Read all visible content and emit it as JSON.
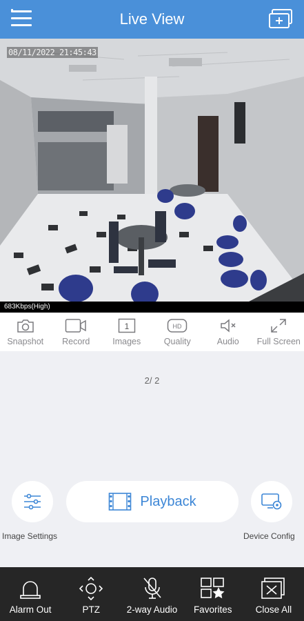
{
  "header": {
    "title": "Live View",
    "menu_icon": "hamburger-menu-icon",
    "split_icon": "add-window-icon"
  },
  "video": {
    "osd_timestamp": "08/11/2022 21:45:43",
    "bitrate_label": "683Kbps(High)"
  },
  "toolbar": {
    "items": [
      {
        "label": "Snapshot",
        "icon": "camera-icon"
      },
      {
        "label": "Record",
        "icon": "video-record-icon"
      },
      {
        "label": "Images",
        "icon": "images-icon",
        "badge": "1"
      },
      {
        "label": "Quality",
        "icon": "hd-quality-icon",
        "badge": "HD"
      },
      {
        "label": "Audio",
        "icon": "speaker-muted-icon"
      },
      {
        "label": "Full Screen",
        "icon": "fullscreen-icon"
      }
    ]
  },
  "main": {
    "page_indicator": "2/ 2",
    "image_settings_label": "Image Settings",
    "playback_label": "Playback",
    "device_config_label": "Device Config"
  },
  "bottombar": {
    "items": [
      {
        "label": "Alarm Out",
        "icon": "alarm-light-icon"
      },
      {
        "label": "PTZ",
        "icon": "ptz-direction-icon"
      },
      {
        "label": "2-way Audio",
        "icon": "microphone-muted-icon"
      },
      {
        "label": "Favorites",
        "icon": "favorites-star-icon"
      },
      {
        "label": "Close All",
        "icon": "close-all-icon"
      }
    ]
  },
  "colors": {
    "header_bg": "#4a90d9",
    "accent": "#3c86d6",
    "bottombar_bg": "#262626",
    "page_bg": "#eff0f4"
  }
}
